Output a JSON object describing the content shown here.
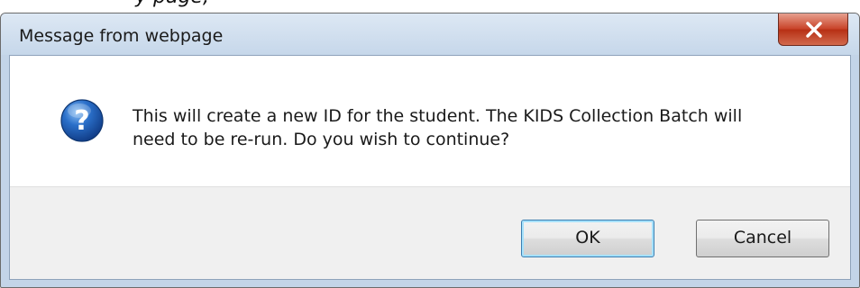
{
  "background_fragment": "y page,",
  "dialog": {
    "title": "Message from webpage",
    "close_icon": "close-icon",
    "question_icon": "question-icon",
    "message_lines": [
      "This will create a new ID for the student.  The KIDS Collection Batch will",
      "need to be re-run.  Do you wish to continue?"
    ],
    "buttons": {
      "ok": "OK",
      "cancel": "Cancel"
    },
    "colors": {
      "titlebar": "#c6d7ea",
      "close_button": "#c9452b",
      "question_icon": "#2a6fc9",
      "default_button_focus": "#3c7fb1"
    }
  }
}
